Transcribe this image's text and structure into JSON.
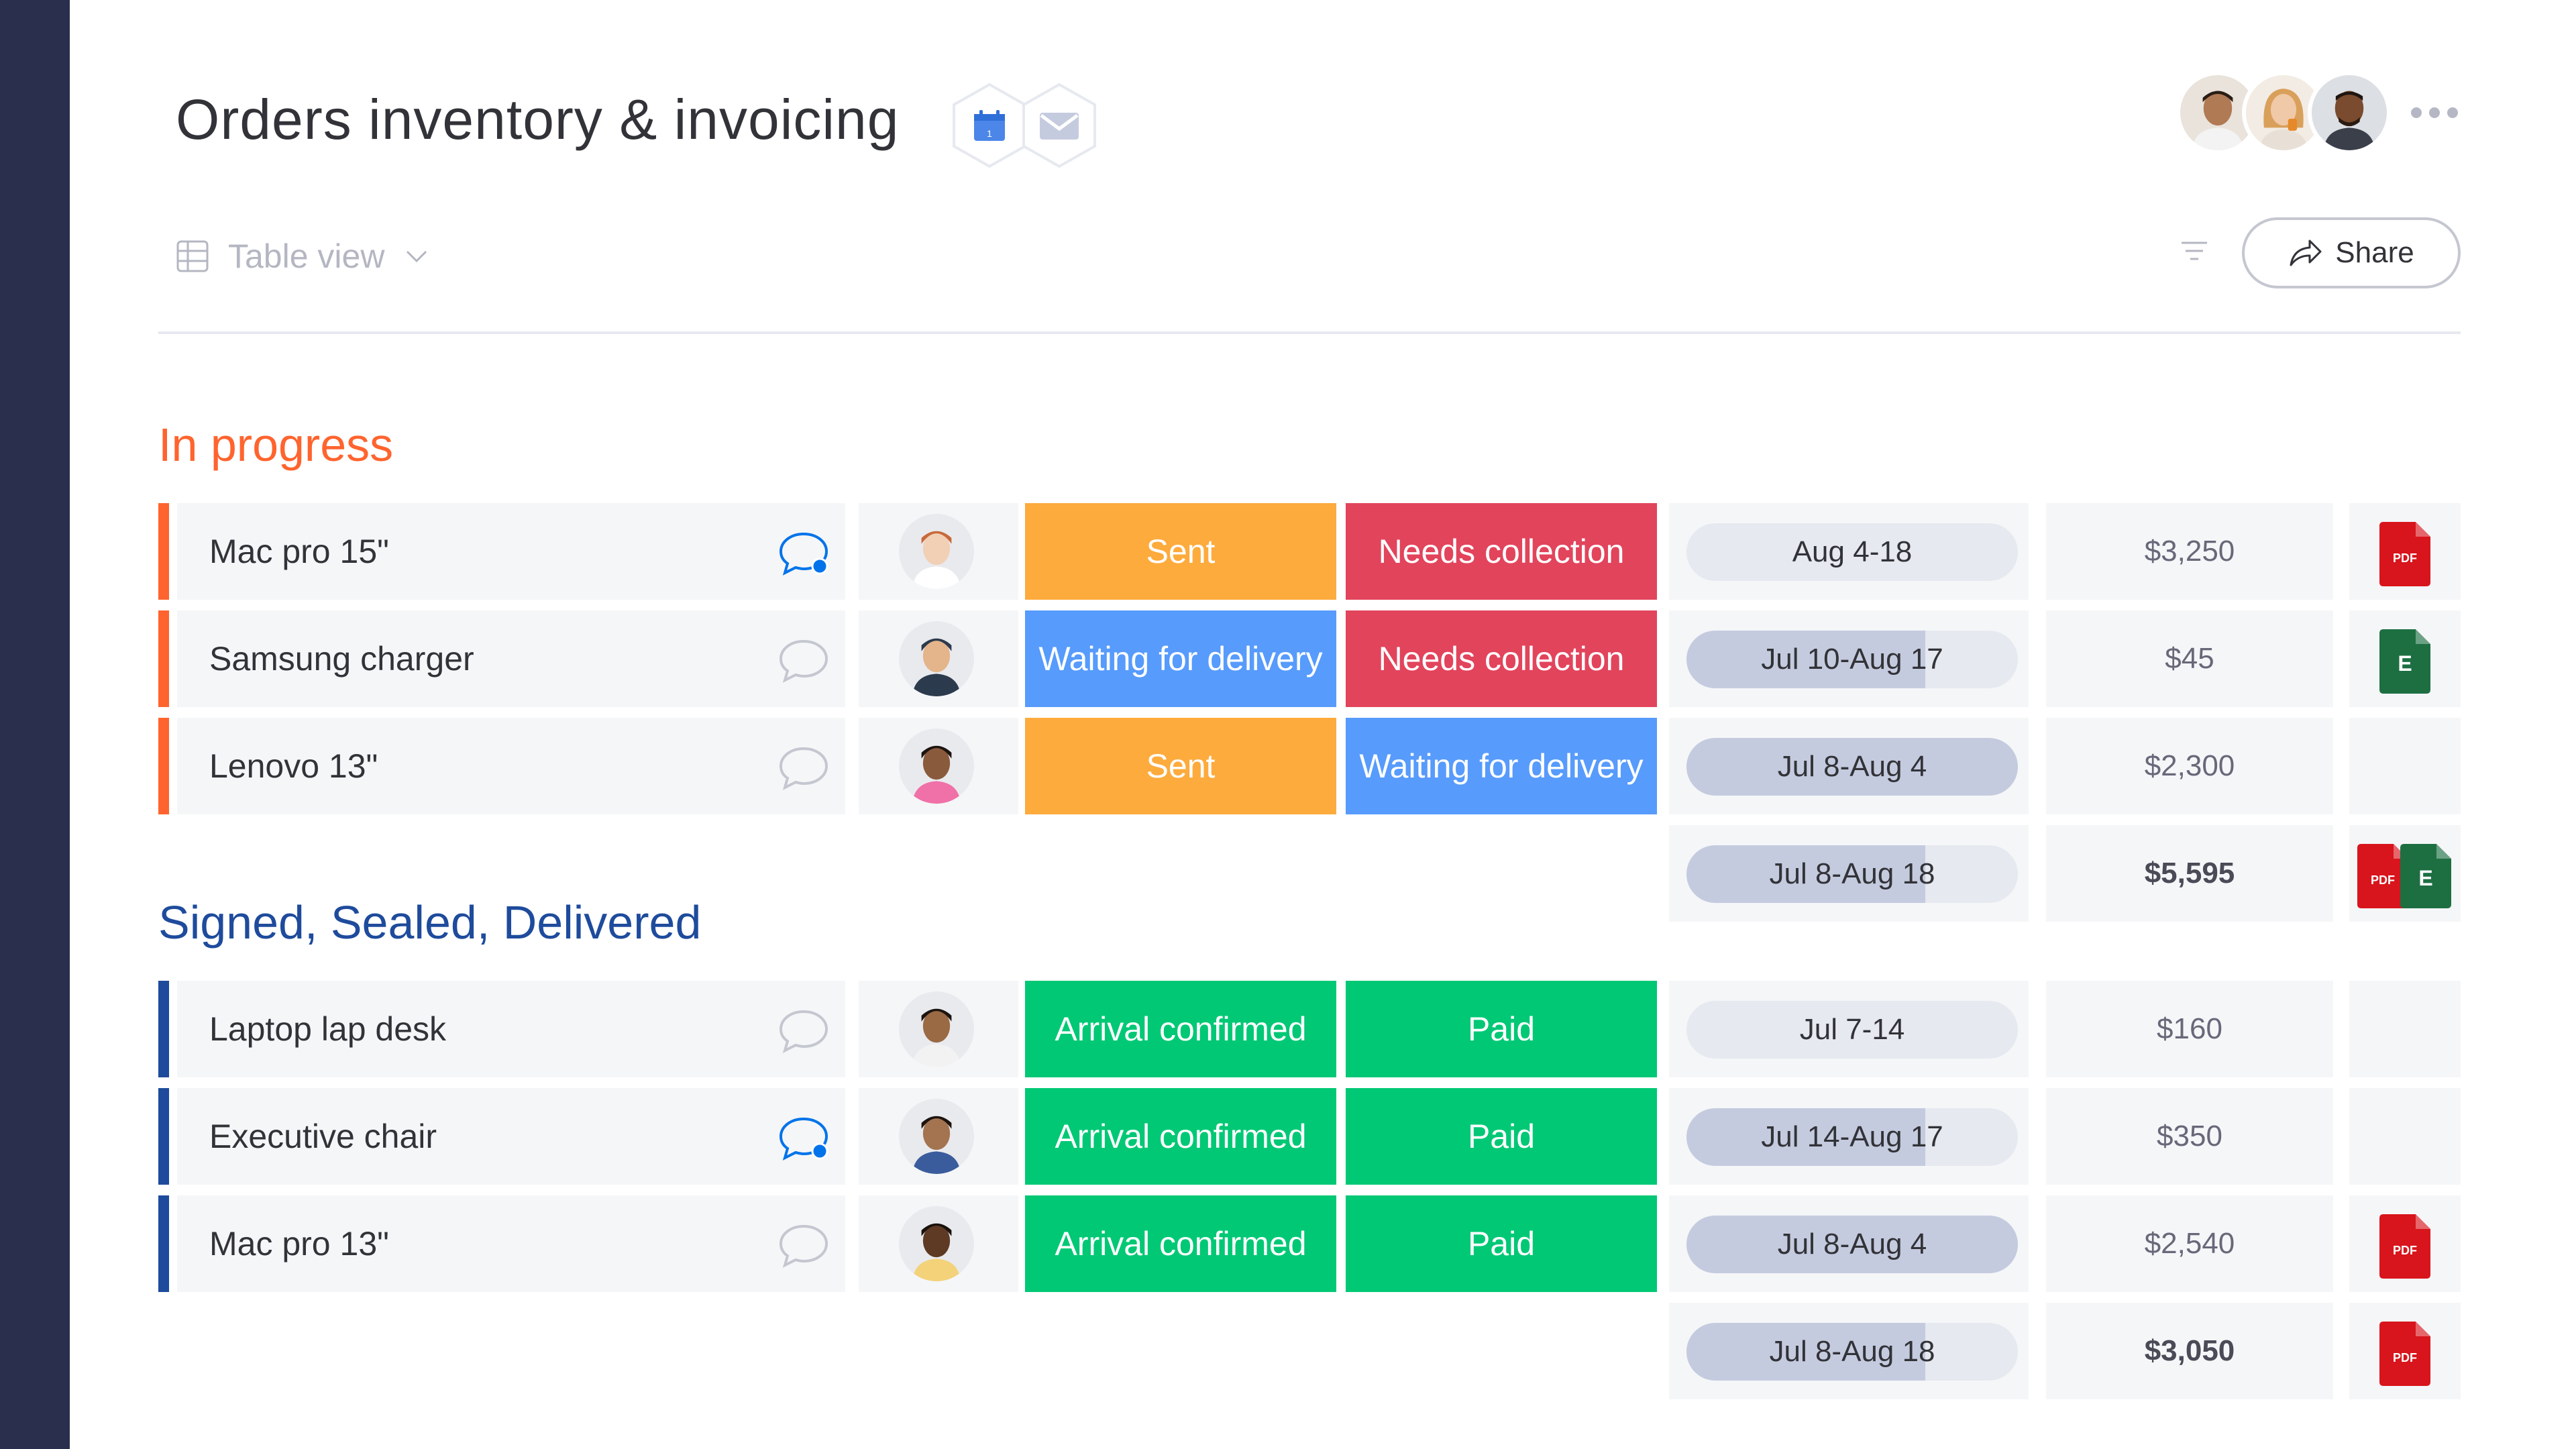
{
  "board": {
    "title": "Orders inventory & invoicing",
    "integrations": [
      "calendar-icon",
      "mail-icon"
    ]
  },
  "subscribers": [
    {
      "avatar": "person-avatar-1"
    },
    {
      "avatar": "person-avatar-2"
    },
    {
      "avatar": "person-avatar-3"
    }
  ],
  "toolbar": {
    "view_label": "Table view",
    "share_label": "Share"
  },
  "colors": {
    "left_rail": "#292f4c",
    "group_in_progress": "#ff642e",
    "group_delivered": "#1e4b9c",
    "status_sent": "#fdab3d",
    "status_needs_collection": "#e2445c",
    "status_waiting": "#579bfc",
    "status_done": "#00c875",
    "timeline_fill": "#c5cbdf",
    "timeline_track": "#e6e9ef"
  },
  "groups": [
    {
      "title": "In progress",
      "items": [
        {
          "name": "Mac pro 15\"",
          "has_updates": true,
          "status1": "Sent",
          "status2": "Needs collection",
          "timeline": "Aug 4-18",
          "timeline_progress": 0.0,
          "price": "$3,250",
          "files": [
            "pdf"
          ]
        },
        {
          "name": "Samsung charger",
          "has_updates": false,
          "status1": "Waiting for delivery",
          "status2": "Needs collection",
          "timeline": "Jul 10-Aug 17",
          "timeline_progress": 0.72,
          "price": "$45",
          "files": [
            "excel"
          ]
        },
        {
          "name": "Lenovo 13\"",
          "has_updates": false,
          "status1": "Sent",
          "status2": "Waiting for delivery",
          "timeline": "Jul 8-Aug 4",
          "timeline_progress": 1.0,
          "price": "$2,300",
          "files": []
        }
      ],
      "summary": {
        "timeline": "Jul 8-Aug 18",
        "timeline_progress": 0.72,
        "price": "$5,595",
        "files": [
          "pdf",
          "excel"
        ]
      }
    },
    {
      "title": "Signed, Sealed, Delivered",
      "items": [
        {
          "name": "Laptop lap desk",
          "has_updates": false,
          "status1": "Arrival confirmed",
          "status2": "Paid",
          "timeline": "Jul 7-14",
          "timeline_progress": 0.0,
          "price": "$160",
          "files": []
        },
        {
          "name": "Executive chair",
          "has_updates": true,
          "status1": "Arrival confirmed",
          "status2": "Paid",
          "timeline": "Jul 14-Aug 17",
          "timeline_progress": 0.72,
          "price": "$350",
          "files": []
        },
        {
          "name": "Mac pro 13\"",
          "has_updates": false,
          "status1": "Arrival confirmed",
          "status2": "Paid",
          "timeline": "Jul 8-Aug 4",
          "timeline_progress": 1.0,
          "price": "$2,540",
          "files": [
            "pdf"
          ]
        }
      ],
      "summary": {
        "timeline": "Jul 8-Aug 18",
        "timeline_progress": 0.72,
        "price": "$3,050",
        "files": [
          "pdf"
        ]
      }
    }
  ],
  "file_labels": {
    "pdf": "PDF",
    "excel": "E"
  }
}
